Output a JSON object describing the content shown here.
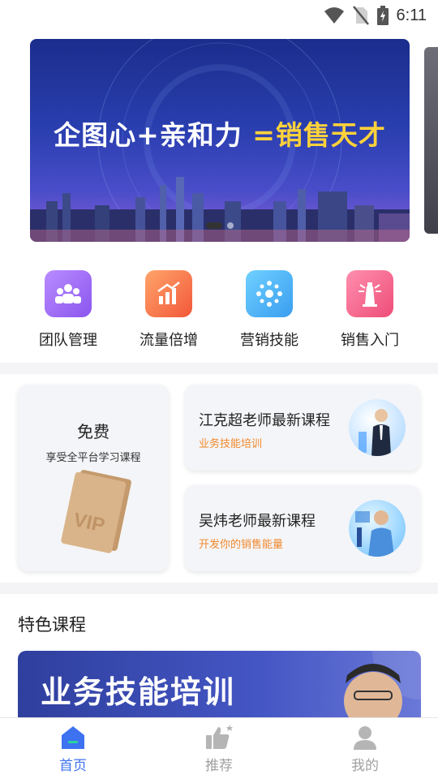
{
  "status_bar": {
    "time": "6:11",
    "icons": [
      "wifi-icon",
      "no-sim-icon",
      "battery-charging-icon"
    ]
  },
  "banner": {
    "title_main": "企图心+亲和力 ",
    "title_accent": "=销售天才",
    "slide_count": 2,
    "active_slide": 1
  },
  "categories": [
    {
      "label": "团队管理",
      "icon": "team-icon",
      "color": "#9b6bf0"
    },
    {
      "label": "流量倍增",
      "icon": "growth-chart-icon",
      "color": "#f2743e"
    },
    {
      "label": "营销技能",
      "icon": "network-icon",
      "color": "#3fb2ef"
    },
    {
      "label": "销售入门",
      "icon": "lighthouse-icon",
      "color": "#f0557d"
    }
  ],
  "promo": {
    "free": {
      "title": "免费",
      "subtitle": "享受全平台学习课程"
    },
    "courses": [
      {
        "title": "江克超老师最新课程",
        "subtitle": "业务技能培训"
      },
      {
        "title": "吴炜老师最新课程",
        "subtitle": "开发你的销售能量"
      }
    ]
  },
  "featured": {
    "section_title": "特色课程",
    "banner_title": "业务技能培训"
  },
  "tab_bar": {
    "tabs": [
      {
        "label": "首页",
        "icon": "home-icon",
        "active": true
      },
      {
        "label": "推荐",
        "icon": "thumbs-up-icon",
        "active": false
      },
      {
        "label": "我的",
        "icon": "user-icon",
        "active": false
      }
    ]
  },
  "colors": {
    "accent": "#3d72f0",
    "course_subtitle": "#f0892e",
    "banner_accent": "#ffd23a"
  }
}
